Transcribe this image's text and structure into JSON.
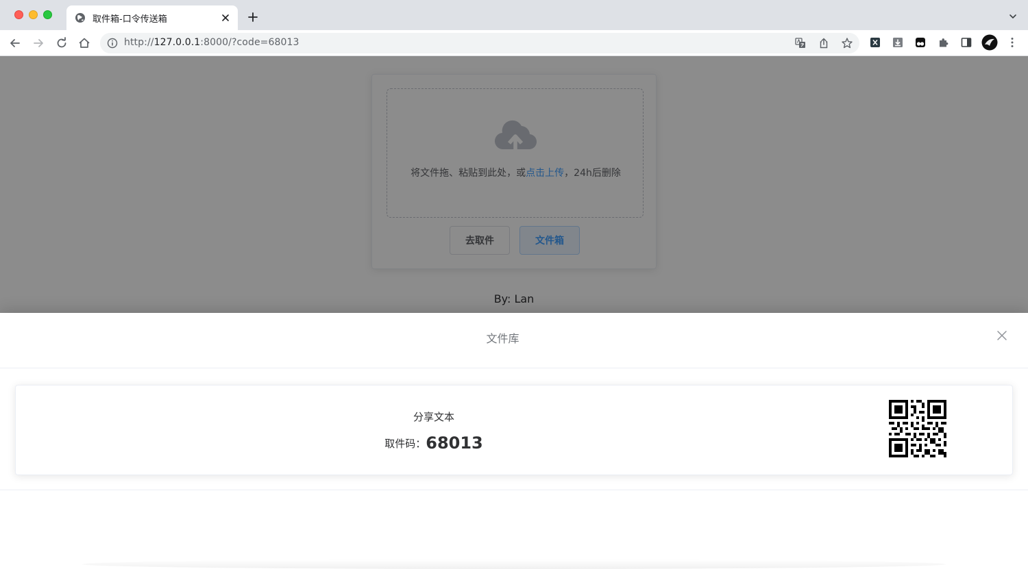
{
  "browser": {
    "tab_title": "取件箱-口令传送箱",
    "url_scheme": "http://",
    "url_host": "127.0.0.1",
    "url_rest": ":8000/?code=68013"
  },
  "page": {
    "drop_text_before": "将文件拖、粘贴到此处，或",
    "drop_link": "点击上传",
    "drop_text_after": "，24h后删除",
    "fetch_button": "去取件",
    "filebox_button": "文件箱",
    "author": "By: Lan"
  },
  "drawer": {
    "title": "文件库",
    "items": [
      {
        "name": "分享文本",
        "code_label": "取件码：",
        "code": "68013"
      }
    ]
  },
  "colors": {
    "accent": "#409eff",
    "overlay": "rgba(0,0,0,0.45)"
  },
  "icons": [
    "globe-icon",
    "close-icon",
    "plus-icon",
    "back-icon",
    "forward-icon",
    "reload-icon",
    "home-icon",
    "info-icon",
    "translate-icon",
    "share-icon",
    "star-icon",
    "extension-icon",
    "puzzle-icon",
    "sidepanel-icon",
    "avatar",
    "menu-icon",
    "upload-cloud-icon",
    "qr-code-icon"
  ]
}
